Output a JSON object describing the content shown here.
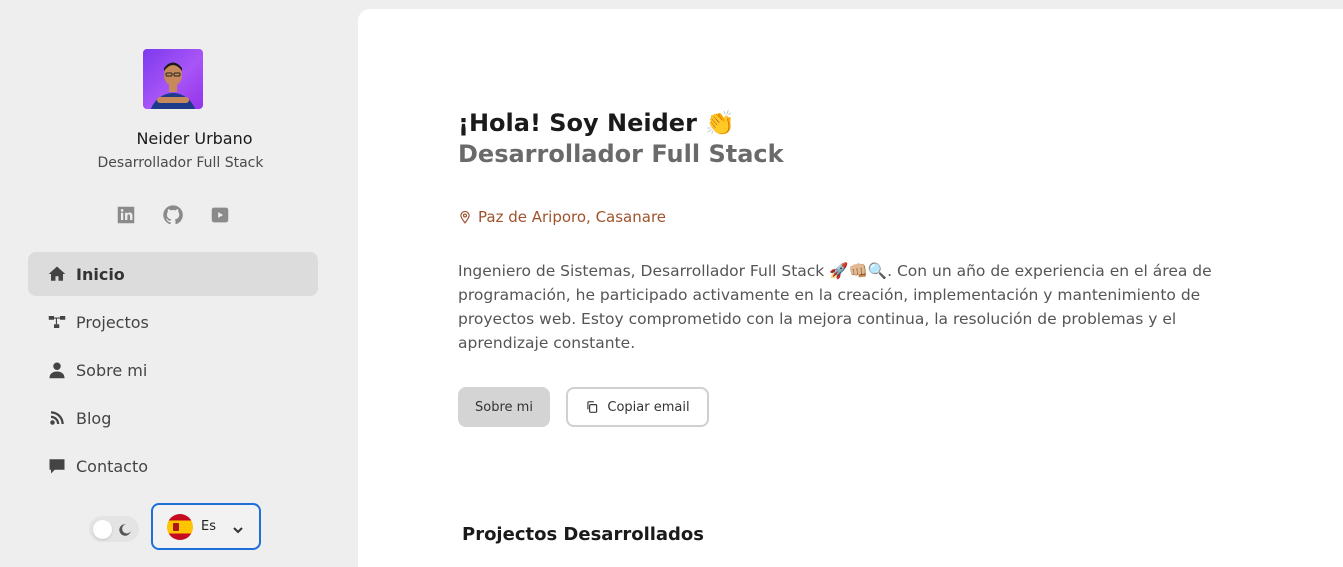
{
  "profile": {
    "name": "Neider Urbano",
    "role": "Desarrollador Full Stack"
  },
  "socials": [
    {
      "icon": "linkedin-icon"
    },
    {
      "icon": "github-icon"
    },
    {
      "icon": "youtube-icon"
    }
  ],
  "nav": {
    "items": [
      {
        "label": "Inicio",
        "icon": "home-icon",
        "active": true
      },
      {
        "label": "Projectos",
        "icon": "projects-icon",
        "active": false
      },
      {
        "label": "Sobre mi",
        "icon": "user-icon",
        "active": false
      },
      {
        "label": "Blog",
        "icon": "blog-icon",
        "active": false
      },
      {
        "label": "Contacto",
        "icon": "chat-icon",
        "active": false
      }
    ]
  },
  "language": {
    "selected": "Es",
    "icon": "spain-flag-icon"
  },
  "hero": {
    "greeting": "¡Hola! Soy Neider 👏",
    "subtitle": "Desarrollador Full Stack",
    "location": "Paz de Ariporo, Casanare",
    "bio": "Ingeniero de Sistemas, Desarrollador Full Stack 🚀👊🏼🔍. Con un año de experiencia en el área de programación, he participado activamente en la creación, implementación y mantenimiento de proyectos web. Estoy comprometido con la mejora continua, la resolución de problemas y el aprendizaje constante.",
    "about_button": "Sobre mi",
    "copy_button": "Copiar email"
  },
  "projects_section": {
    "title": "Projectos Desarrollados"
  },
  "colors": {
    "accent_location": "#a0522d",
    "focus_border": "#1e6fd9",
    "avatar_bg": "#7c3aed"
  }
}
